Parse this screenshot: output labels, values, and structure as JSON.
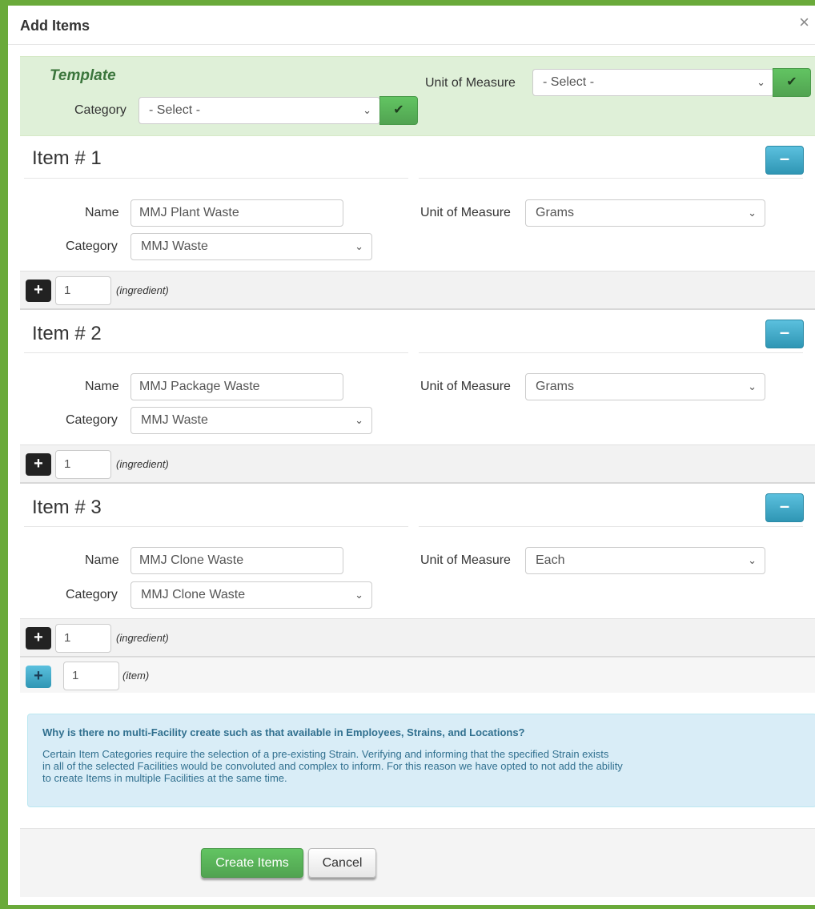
{
  "modal": {
    "title": "Add Items",
    "close_glyph": "×"
  },
  "template": {
    "title": "Template",
    "unit_label": "Unit of Measure",
    "unit_value": "- Select -",
    "category_label": "Category",
    "category_value": "- Select -"
  },
  "items": [
    {
      "heading": "Item # 1",
      "name_label": "Name",
      "name": "MMJ Plant Waste",
      "category_label": "Category",
      "category": "MMJ Waste",
      "unit_label": "Unit of Measure",
      "unit": "Grams",
      "ingredient_count": "1",
      "ingredient_hint": "(ingredient)"
    },
    {
      "heading": "Item # 2",
      "name_label": "Name",
      "name": "MMJ Package Waste",
      "category_label": "Category",
      "category": "MMJ Waste",
      "unit_label": "Unit of Measure",
      "unit": "Grams",
      "ingredient_count": "1",
      "ingredient_hint": "(ingredient)"
    },
    {
      "heading": "Item # 3",
      "name_label": "Name",
      "name": "MMJ Clone Waste",
      "category_label": "Category",
      "category": "MMJ Clone Waste",
      "unit_label": "Unit of Measure",
      "unit": "Each",
      "ingredient_count": "1",
      "ingredient_hint": "(ingredient)"
    }
  ],
  "add_item": {
    "count": "1",
    "hint": "(item)"
  },
  "info": {
    "title": "Why is there no multi-Facility create such as that available in Employees, Strains, and Locations?",
    "line1": "Certain Item Categories require the selection of a pre-existing Strain. Verifying and informing that the specified Strain exists",
    "line2": "in all of the selected Facilities would be convoluted and complex to inform. For this reason we have opted to not add the ability",
    "line3": "to create Items in multiple Facilities at the same time."
  },
  "footer": {
    "create_label": "Create Items",
    "cancel_label": "Cancel"
  },
  "icons": {
    "check": "check-icon",
    "minus": "minus-icon",
    "plus": "plus-icon",
    "chevron": "chevron-down-icon"
  },
  "colors": {
    "frame": "#6aaa3a",
    "success": "#51a351",
    "info": "#2f96b4",
    "template_bg": "#dff0d8"
  }
}
